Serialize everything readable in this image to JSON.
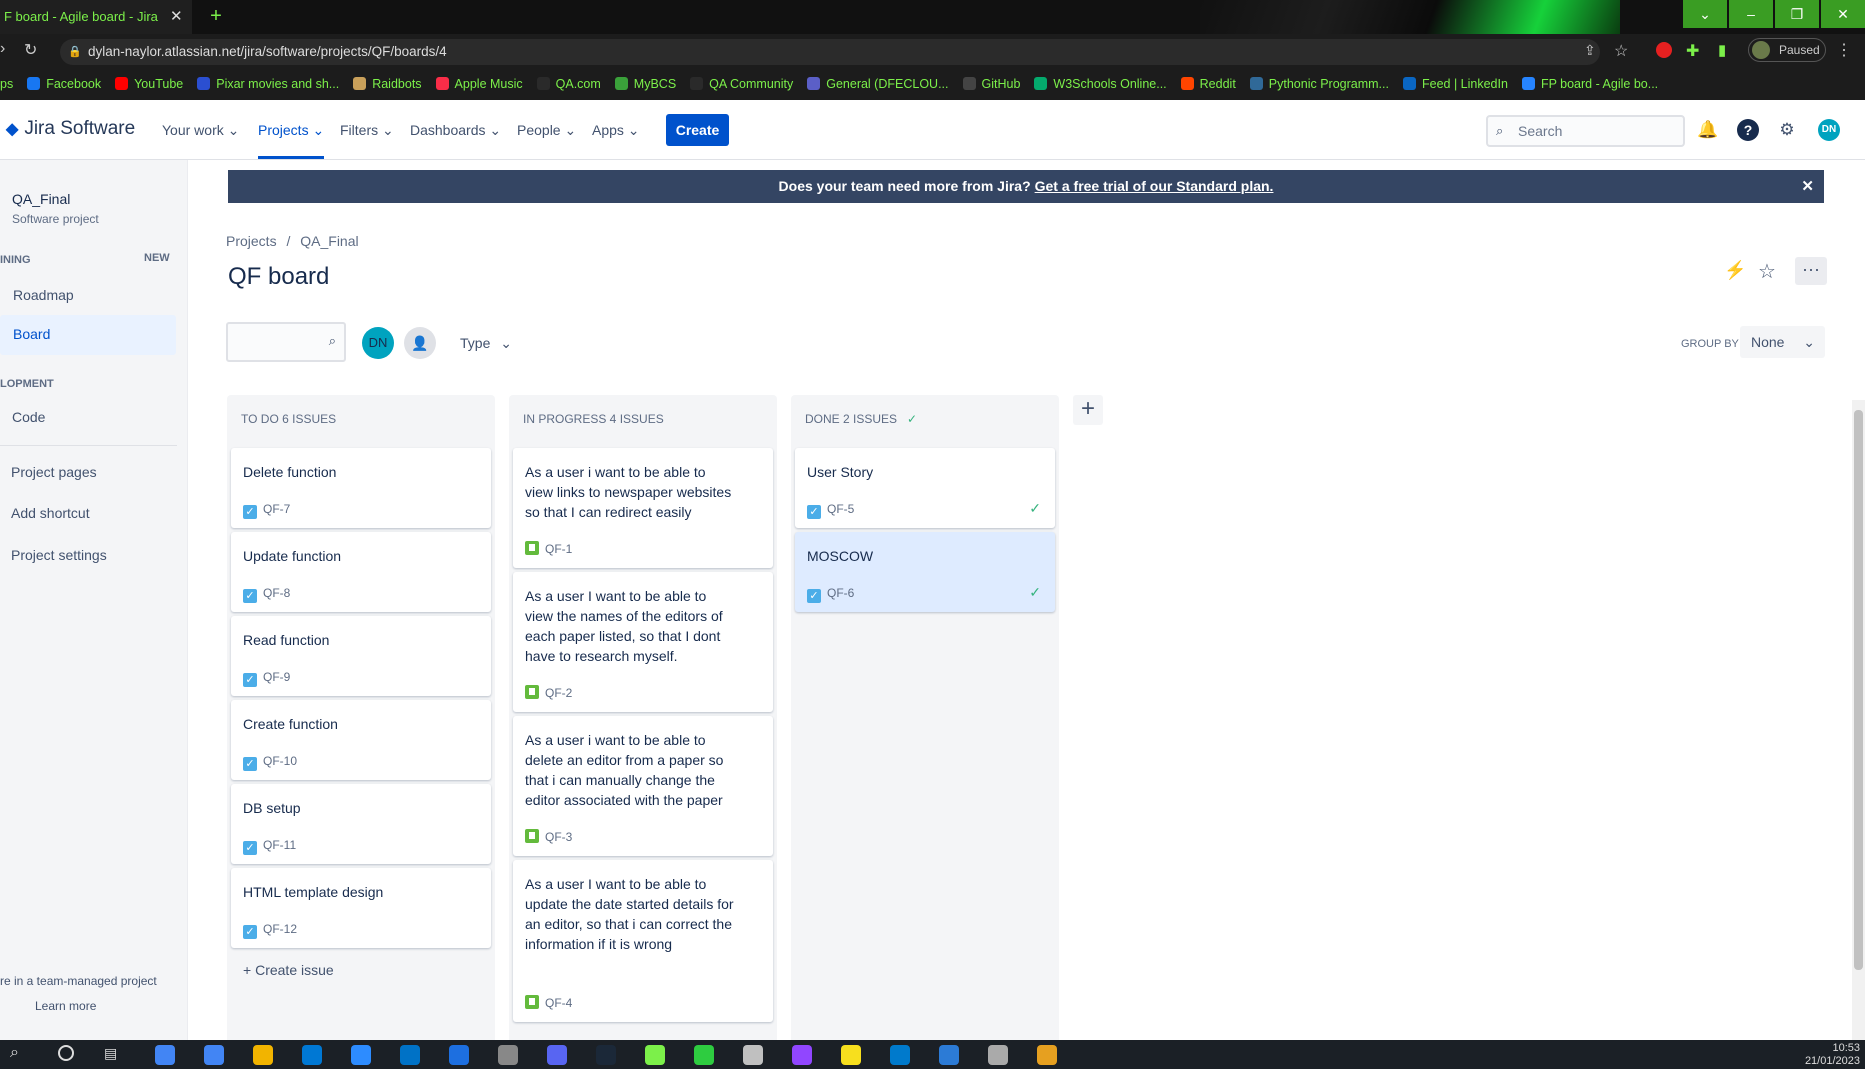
{
  "browser": {
    "tab_title": "F board - Agile board - Jira",
    "tab_close": "✕",
    "new_tab": "+",
    "url": "dylan-naylor.atlassian.net/jira/software/projects/QF/boards/4",
    "profile_status": "Paused",
    "bookmarks": [
      {
        "label": "ps",
        "color": "#7cf04a"
      },
      {
        "label": "Facebook",
        "color": "#1877f2"
      },
      {
        "label": "YouTube",
        "color": "#ff0000"
      },
      {
        "label": "Pixar movies and sh...",
        "color": "#2b4fd1"
      },
      {
        "label": "Raidbots",
        "color": "#c9a05a"
      },
      {
        "label": "Apple Music",
        "color": "#fa2d48"
      },
      {
        "label": "QA.com",
        "color": "#2a2a2a"
      },
      {
        "label": "MyBCS",
        "color": "#3aa13a"
      },
      {
        "label": "QA Community",
        "color": "#2a2a2a"
      },
      {
        "label": "General (DFECLOU...",
        "color": "#5b5fc7"
      },
      {
        "label": "GitHub",
        "color": "#444444"
      },
      {
        "label": "W3Schools Online...",
        "color": "#04aa6d"
      },
      {
        "label": "Reddit",
        "color": "#ff4500"
      },
      {
        "label": "Pythonic Programm...",
        "color": "#306998"
      },
      {
        "label": "Feed | LinkedIn",
        "color": "#0a66c2"
      },
      {
        "label": "FP board - Agile bo...",
        "color": "#2684ff"
      }
    ]
  },
  "jira": {
    "product": "Jira Software",
    "nav": [
      "Your work",
      "Projects",
      "Filters",
      "Dashboards",
      "People",
      "Apps"
    ],
    "create": "Create",
    "search_placeholder": "Search",
    "avatar": "DN"
  },
  "sidebar": {
    "project_name": "QA_Final",
    "project_type": "Software project",
    "planning_header": "INING",
    "new_badge": "NEW",
    "roadmap": "Roadmap",
    "board": "Board",
    "dev_header": "LOPMENT",
    "code": "Code",
    "project_pages": "Project pages",
    "add_shortcut": "Add shortcut",
    "project_settings": "Project settings",
    "footer_text": "re in a team-managed project",
    "learn_more": "Learn more"
  },
  "banner": {
    "text": "Does your team need more from Jira?",
    "link": "Get a free trial of our Standard plan.",
    "close": "✕"
  },
  "breadcrumb": {
    "root": "Projects",
    "sep": "/",
    "project": "QA_Final"
  },
  "board": {
    "title": "QF board",
    "avatar": "DN",
    "type_filter": "Type",
    "group_by_label": "GROUP BY",
    "group_by_value": "None",
    "columns": [
      {
        "title": "TO DO 6 ISSUES",
        "cards": [
          {
            "title": "Delete function",
            "key": "QF-7",
            "type": "task"
          },
          {
            "title": "Update function",
            "key": "QF-8",
            "type": "task"
          },
          {
            "title": "Read function",
            "key": "QF-9",
            "type": "task"
          },
          {
            "title": "Create function",
            "key": "QF-10",
            "type": "task"
          },
          {
            "title": "DB setup",
            "key": "QF-11",
            "type": "task"
          },
          {
            "title": "HTML template design",
            "key": "QF-12",
            "type": "task"
          }
        ],
        "footer": "Create issue"
      },
      {
        "title": "IN PROGRESS 4 ISSUES",
        "cards": [
          {
            "title": "As a user i want to be able to view links to newspaper websites so that I can redirect easily",
            "key": "QF-1",
            "type": "story"
          },
          {
            "title": "As a user I want to be able to view the names of the editors of each paper listed, so that I dont have to research myself.",
            "key": "QF-2",
            "type": "story"
          },
          {
            "title": "As a user i want to be able to delete an editor from a paper so that i can manually change the editor associated with the paper",
            "key": "QF-3",
            "type": "story"
          },
          {
            "title": "As a user I want to be able to update the date started details for an editor, so that i can correct the information if it is wrong",
            "key": "QF-4",
            "type": "story"
          }
        ]
      },
      {
        "title": "DONE 2 ISSUES",
        "cards": [
          {
            "title": "User Story",
            "key": "QF-5",
            "type": "task"
          },
          {
            "title": "MOSCOW",
            "key": "QF-6",
            "type": "task"
          }
        ]
      }
    ]
  },
  "taskbar": {
    "time": "10:53",
    "date": "21/01/2023"
  }
}
